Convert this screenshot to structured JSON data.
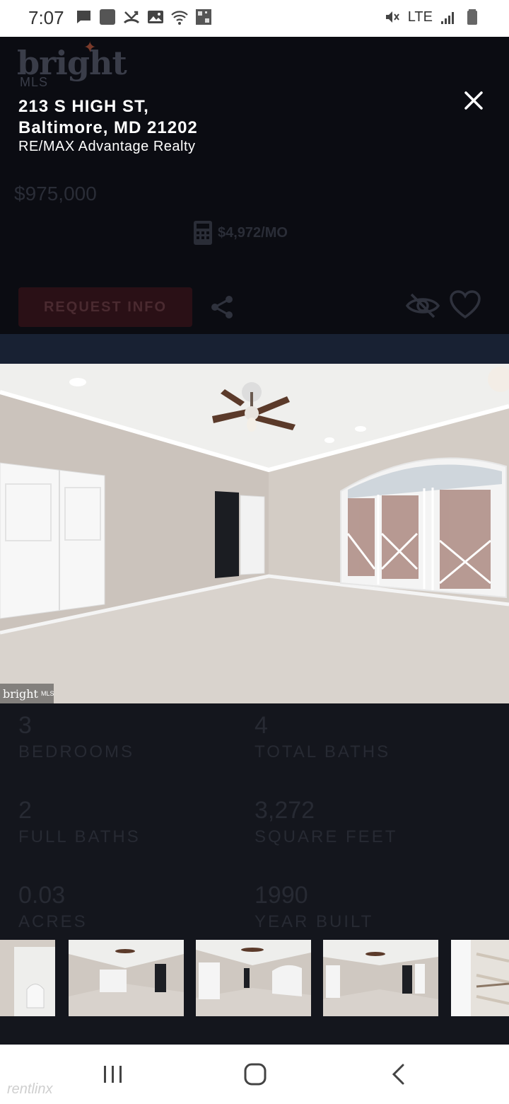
{
  "status_bar": {
    "time": "7:07",
    "network": "LTE",
    "icons_left": [
      "message-icon",
      "square-icon",
      "missed-call-icon",
      "image-icon",
      "wifi-icon",
      "qr-icon"
    ],
    "icons_right": [
      "mute-icon",
      "lte-icon",
      "signal-icon",
      "battery-icon"
    ]
  },
  "listing": {
    "address_line1": "213 S HIGH ST,",
    "address_line2": "Baltimore, MD 21202",
    "agent": "RE/MAX Advantage Realty",
    "price": "$975,000",
    "monthly": "$4,972/MO",
    "request_info": "REQUEST INFO"
  },
  "brand": {
    "name": "bright",
    "sub": "MLS",
    "watermark": "bright",
    "watermark_sub": "MLS"
  },
  "stats": [
    {
      "value": "3",
      "label": "BEDROOMS"
    },
    {
      "value": "4",
      "label": "TOTAL BATHS"
    },
    {
      "value": "2",
      "label": "FULL BATHS"
    },
    {
      "value": "3,272",
      "label": "SQUARE FEET"
    },
    {
      "value": "0.03",
      "label": "ACRES"
    },
    {
      "value": "1990",
      "label": "YEAR BUILT"
    }
  ],
  "footer": {
    "watermark": "rentlinx"
  },
  "colors": {
    "backdrop": "#14161d",
    "overlay_text": "#ffffff",
    "cta_dim": "#2a1016",
    "band_dim": "#182133"
  }
}
